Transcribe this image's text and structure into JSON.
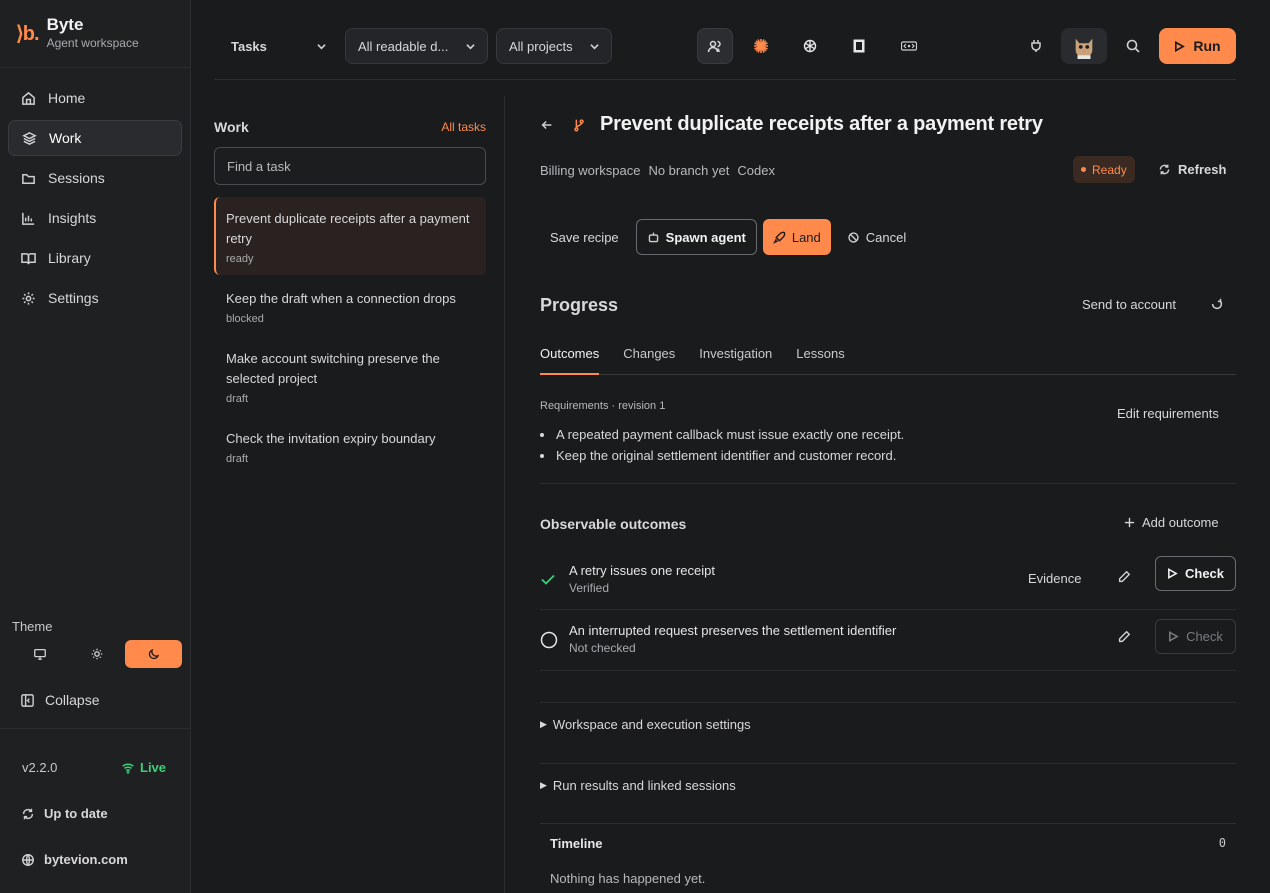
{
  "brand": {
    "logo": "⟩b.",
    "name": "Byte",
    "subtitle": "Agent workspace"
  },
  "sidebar": {
    "items": [
      {
        "label": "Home",
        "icon": "home-icon"
      },
      {
        "label": "Work",
        "icon": "layers-icon",
        "active": true
      },
      {
        "label": "Sessions",
        "icon": "folder-icon"
      },
      {
        "label": "Insights",
        "icon": "bar-chart-icon"
      },
      {
        "label": "Library",
        "icon": "book-icon"
      },
      {
        "label": "Settings",
        "icon": "gear-icon"
      }
    ],
    "theme_label": "Theme",
    "theme_options": [
      "system",
      "light",
      "dark"
    ],
    "theme_selected": "dark",
    "collapse_label": "Collapse",
    "version": "v2.2.0",
    "live_label": "Live",
    "update_label": "Up to date",
    "site_label": "bytevion.com"
  },
  "topbar": {
    "view_select": "Tasks",
    "filter_select": "All readable d...",
    "project_select": "All projects",
    "icons": [
      "users-icon",
      "claude-icon",
      "openai-icon",
      "gemini-icon",
      "code-icon"
    ],
    "run_label": "Run"
  },
  "task_list": {
    "title": "Work",
    "all_link": "All tasks",
    "search_placeholder": "Find a task",
    "tasks": [
      {
        "title": "Prevent duplicate receipts after a payment retry",
        "status": "ready"
      },
      {
        "title": "Keep the draft when a connection drops",
        "status": "blocked"
      },
      {
        "title": "Make account switching preserve the selected project",
        "status": "draft"
      },
      {
        "title": "Check the invitation expiry boundary",
        "status": "draft"
      }
    ]
  },
  "detail": {
    "title": "Prevent duplicate receipts after a payment retry",
    "meta": [
      "Billing workspace",
      "No branch yet",
      "Codex"
    ],
    "status_badge": "Ready",
    "refresh_label": "Refresh",
    "actions": {
      "save_recipe": "Save recipe",
      "spawn_agent": "Spawn agent",
      "land": "Land",
      "cancel": "Cancel"
    },
    "progress_title": "Progress",
    "send_to_account": "Send to account",
    "tabs": [
      "Outcomes",
      "Changes",
      "Investigation",
      "Lessons"
    ],
    "active_tab": "Outcomes",
    "requirements_label": "Requirements · revision 1",
    "edit_requirements": "Edit requirements",
    "requirements": [
      "A repeated payment callback must issue exactly one receipt.",
      "Keep the original settlement identifier and customer record."
    ],
    "observable_title": "Observable outcomes",
    "add_outcome": "Add outcome",
    "outcomes": [
      {
        "title": "A retry issues one receipt",
        "status": "Verified",
        "evidence": "Evidence",
        "check": "Check",
        "verified": true
      },
      {
        "title": "An interrupted request preserves the settlement identifier",
        "status": "Not checked",
        "check": "Check",
        "verified": false
      }
    ],
    "sections": [
      "Workspace and execution settings",
      "Run results and linked sessions"
    ],
    "timeline_title": "Timeline",
    "timeline_count": "0",
    "timeline_empty": "Nothing has happened yet."
  },
  "colors": {
    "accent": "#ff8a4c",
    "live": "#3ccf7a",
    "background": "#1a1b1d"
  }
}
